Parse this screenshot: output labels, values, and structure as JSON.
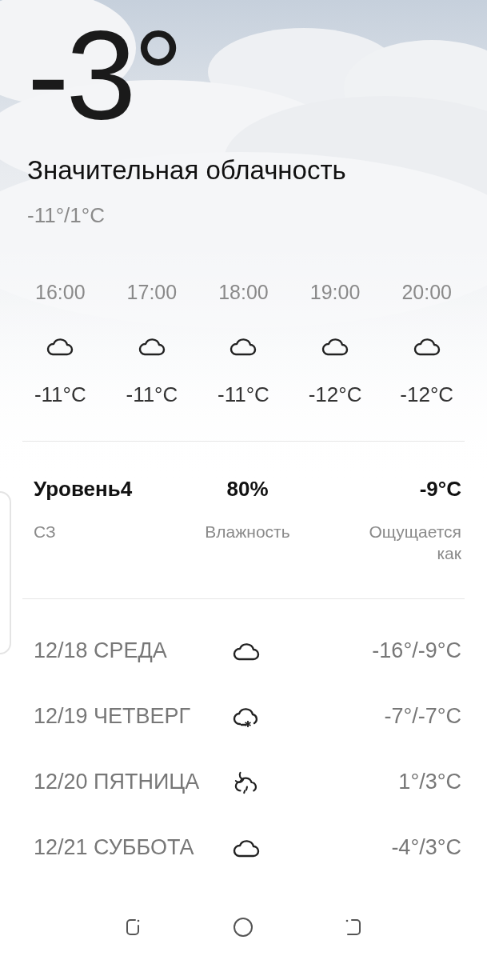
{
  "current": {
    "temperature": "-3°",
    "condition": "Значительная облачность",
    "range": "-11°/1°C"
  },
  "hourly": [
    {
      "time": "16:00",
      "kind": "cloud",
      "temperature": "-11°C"
    },
    {
      "time": "17:00",
      "kind": "cloud",
      "temperature": "-11°C"
    },
    {
      "time": "18:00",
      "kind": "cloud",
      "temperature": "-11°C"
    },
    {
      "time": "19:00",
      "kind": "cloud",
      "temperature": "-12°C"
    },
    {
      "time": "20:00",
      "kind": "cloud",
      "temperature": "-12°C"
    }
  ],
  "details": [
    {
      "value": "Уровень4",
      "label": "СЗ"
    },
    {
      "value": "80%",
      "label": "Влажность"
    },
    {
      "value": "-9°C",
      "label": "Ощущается как"
    }
  ],
  "daily": [
    {
      "date": "12/18",
      "day": "СРЕДА",
      "kind": "cloud",
      "range": "-16°/-9°C"
    },
    {
      "date": "12/19",
      "day": "ЧЕТВЕРГ",
      "kind": "snow",
      "range": "-7°/-7°C"
    },
    {
      "date": "12/20",
      "day": "ПЯТНИЦА",
      "kind": "night-rain",
      "range": "1°/3°C"
    },
    {
      "date": "12/21",
      "day": "СУББОТА",
      "kind": "cloud",
      "range": "-4°/3°C"
    }
  ]
}
